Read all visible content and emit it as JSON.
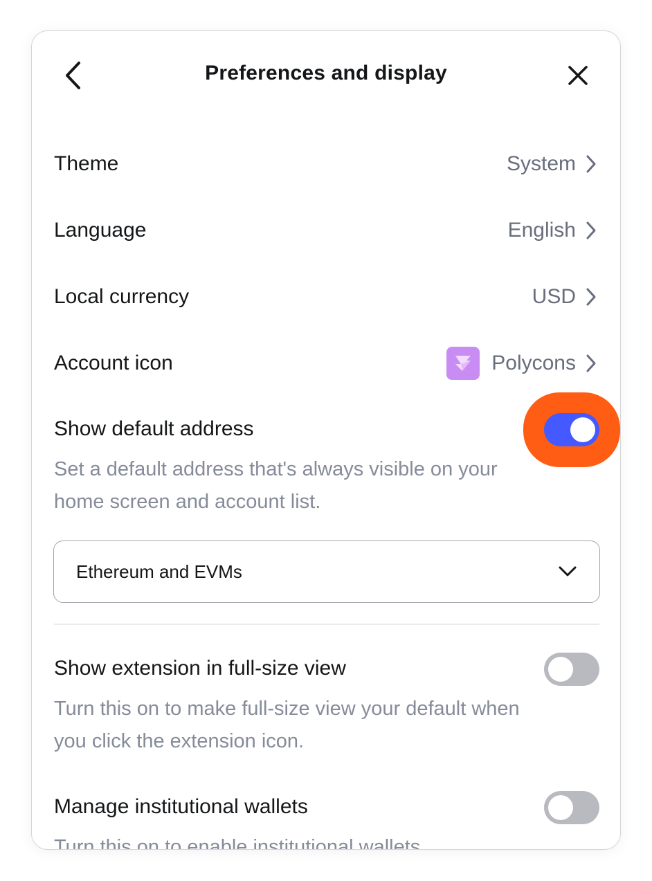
{
  "header": {
    "title": "Preferences and display",
    "back_icon": "chevron-left-icon",
    "close_icon": "close-icon"
  },
  "settings": [
    {
      "label": "Theme",
      "value": "System"
    },
    {
      "label": "Language",
      "value": "English"
    },
    {
      "label": "Local currency",
      "value": "USD"
    },
    {
      "label": "Account icon",
      "value": "Polycons",
      "icon": "polycon-icon"
    }
  ],
  "default_address": {
    "label": "Show default address",
    "description_line1": "Set a default address that's always visible on your",
    "description_line2": "home screen and account list.",
    "enabled": true,
    "select_value": "Ethereum and EVMs"
  },
  "full_size_view": {
    "label": "Show extension in full-size view",
    "description_line1": "Turn this on to make full-size view your default when",
    "description_line2": "you click the extension icon.",
    "enabled": false
  },
  "institutional_wallets": {
    "label": "Manage institutional wallets",
    "description_line1": "Turn this on to enable institutional wallets",
    "enabled": false
  },
  "colors": {
    "toggle_on": "#4459ff",
    "toggle_off": "#b8bac0",
    "highlight": "#ff5d14",
    "polycon": "#c98cf2"
  }
}
